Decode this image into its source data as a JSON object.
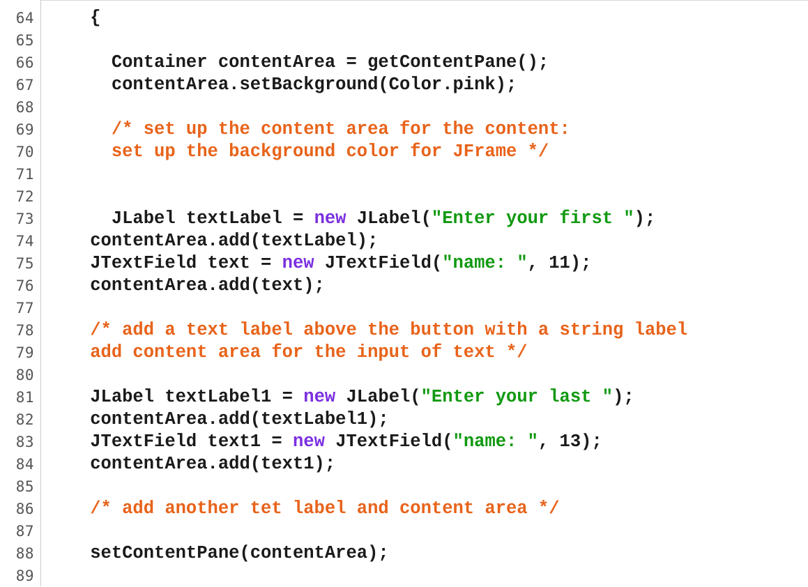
{
  "editor": {
    "colors": {
      "plain": "#1a1a1a",
      "keyword": "#7b2fe0",
      "string": "#119911",
      "comment": "#e8631a",
      "line_number": "#555555"
    },
    "lines": [
      {
        "num": "64",
        "tokens": [
          {
            "t": "plain",
            "s": "    {"
          }
        ]
      },
      {
        "num": "65",
        "tokens": []
      },
      {
        "num": "66",
        "tokens": [
          {
            "t": "plain",
            "s": "      Container contentArea = getContentPane();"
          }
        ]
      },
      {
        "num": "67",
        "tokens": [
          {
            "t": "plain",
            "s": "      contentArea.setBackground(Color.pink);"
          }
        ]
      },
      {
        "num": "68",
        "tokens": []
      },
      {
        "num": "69",
        "tokens": [
          {
            "t": "com",
            "s": "      /* set up the content area for the content:"
          }
        ]
      },
      {
        "num": "70",
        "tokens": [
          {
            "t": "com",
            "s": "      set up the background color for JFrame */"
          }
        ]
      },
      {
        "num": "71",
        "tokens": []
      },
      {
        "num": "72",
        "tokens": []
      },
      {
        "num": "73",
        "tokens": [
          {
            "t": "plain",
            "s": "      JLabel textLabel = "
          },
          {
            "t": "kw",
            "s": "new"
          },
          {
            "t": "plain",
            "s": " JLabel("
          },
          {
            "t": "str",
            "s": "\"Enter your first \""
          },
          {
            "t": "plain",
            "s": ");"
          }
        ]
      },
      {
        "num": "74",
        "tokens": [
          {
            "t": "plain",
            "s": "    contentArea.add(textLabel);"
          }
        ]
      },
      {
        "num": "75",
        "tokens": [
          {
            "t": "plain",
            "s": "    JTextField text = "
          },
          {
            "t": "kw",
            "s": "new"
          },
          {
            "t": "plain",
            "s": " JTextField("
          },
          {
            "t": "str",
            "s": "\"name: \""
          },
          {
            "t": "plain",
            "s": ", 11);"
          }
        ]
      },
      {
        "num": "76",
        "tokens": [
          {
            "t": "plain",
            "s": "    contentArea.add(text);"
          }
        ]
      },
      {
        "num": "77",
        "tokens": []
      },
      {
        "num": "78",
        "tokens": [
          {
            "t": "com",
            "s": "    /* add a text label above the button with a string label"
          }
        ]
      },
      {
        "num": "79",
        "tokens": [
          {
            "t": "com",
            "s": "    add content area for the input of text */"
          }
        ]
      },
      {
        "num": "80",
        "tokens": []
      },
      {
        "num": "81",
        "tokens": [
          {
            "t": "plain",
            "s": "    JLabel textLabel1 = "
          },
          {
            "t": "kw",
            "s": "new"
          },
          {
            "t": "plain",
            "s": " JLabel("
          },
          {
            "t": "str",
            "s": "\"Enter your last \""
          },
          {
            "t": "plain",
            "s": ");"
          }
        ]
      },
      {
        "num": "82",
        "tokens": [
          {
            "t": "plain",
            "s": "    contentArea.add(textLabel1);"
          }
        ]
      },
      {
        "num": "83",
        "tokens": [
          {
            "t": "plain",
            "s": "    JTextField text1 = "
          },
          {
            "t": "kw",
            "s": "new"
          },
          {
            "t": "plain",
            "s": " JTextField("
          },
          {
            "t": "str",
            "s": "\"name: \""
          },
          {
            "t": "plain",
            "s": ", 13);"
          }
        ]
      },
      {
        "num": "84",
        "tokens": [
          {
            "t": "plain",
            "s": "    contentArea.add(text1);"
          }
        ]
      },
      {
        "num": "85",
        "tokens": []
      },
      {
        "num": "86",
        "tokens": [
          {
            "t": "com",
            "s": "    /* add another tet label and content area */"
          }
        ]
      },
      {
        "num": "87",
        "tokens": []
      },
      {
        "num": "88",
        "tokens": [
          {
            "t": "plain",
            "s": "    setContentPane(contentArea);"
          }
        ]
      },
      {
        "num": "89",
        "tokens": []
      }
    ]
  }
}
